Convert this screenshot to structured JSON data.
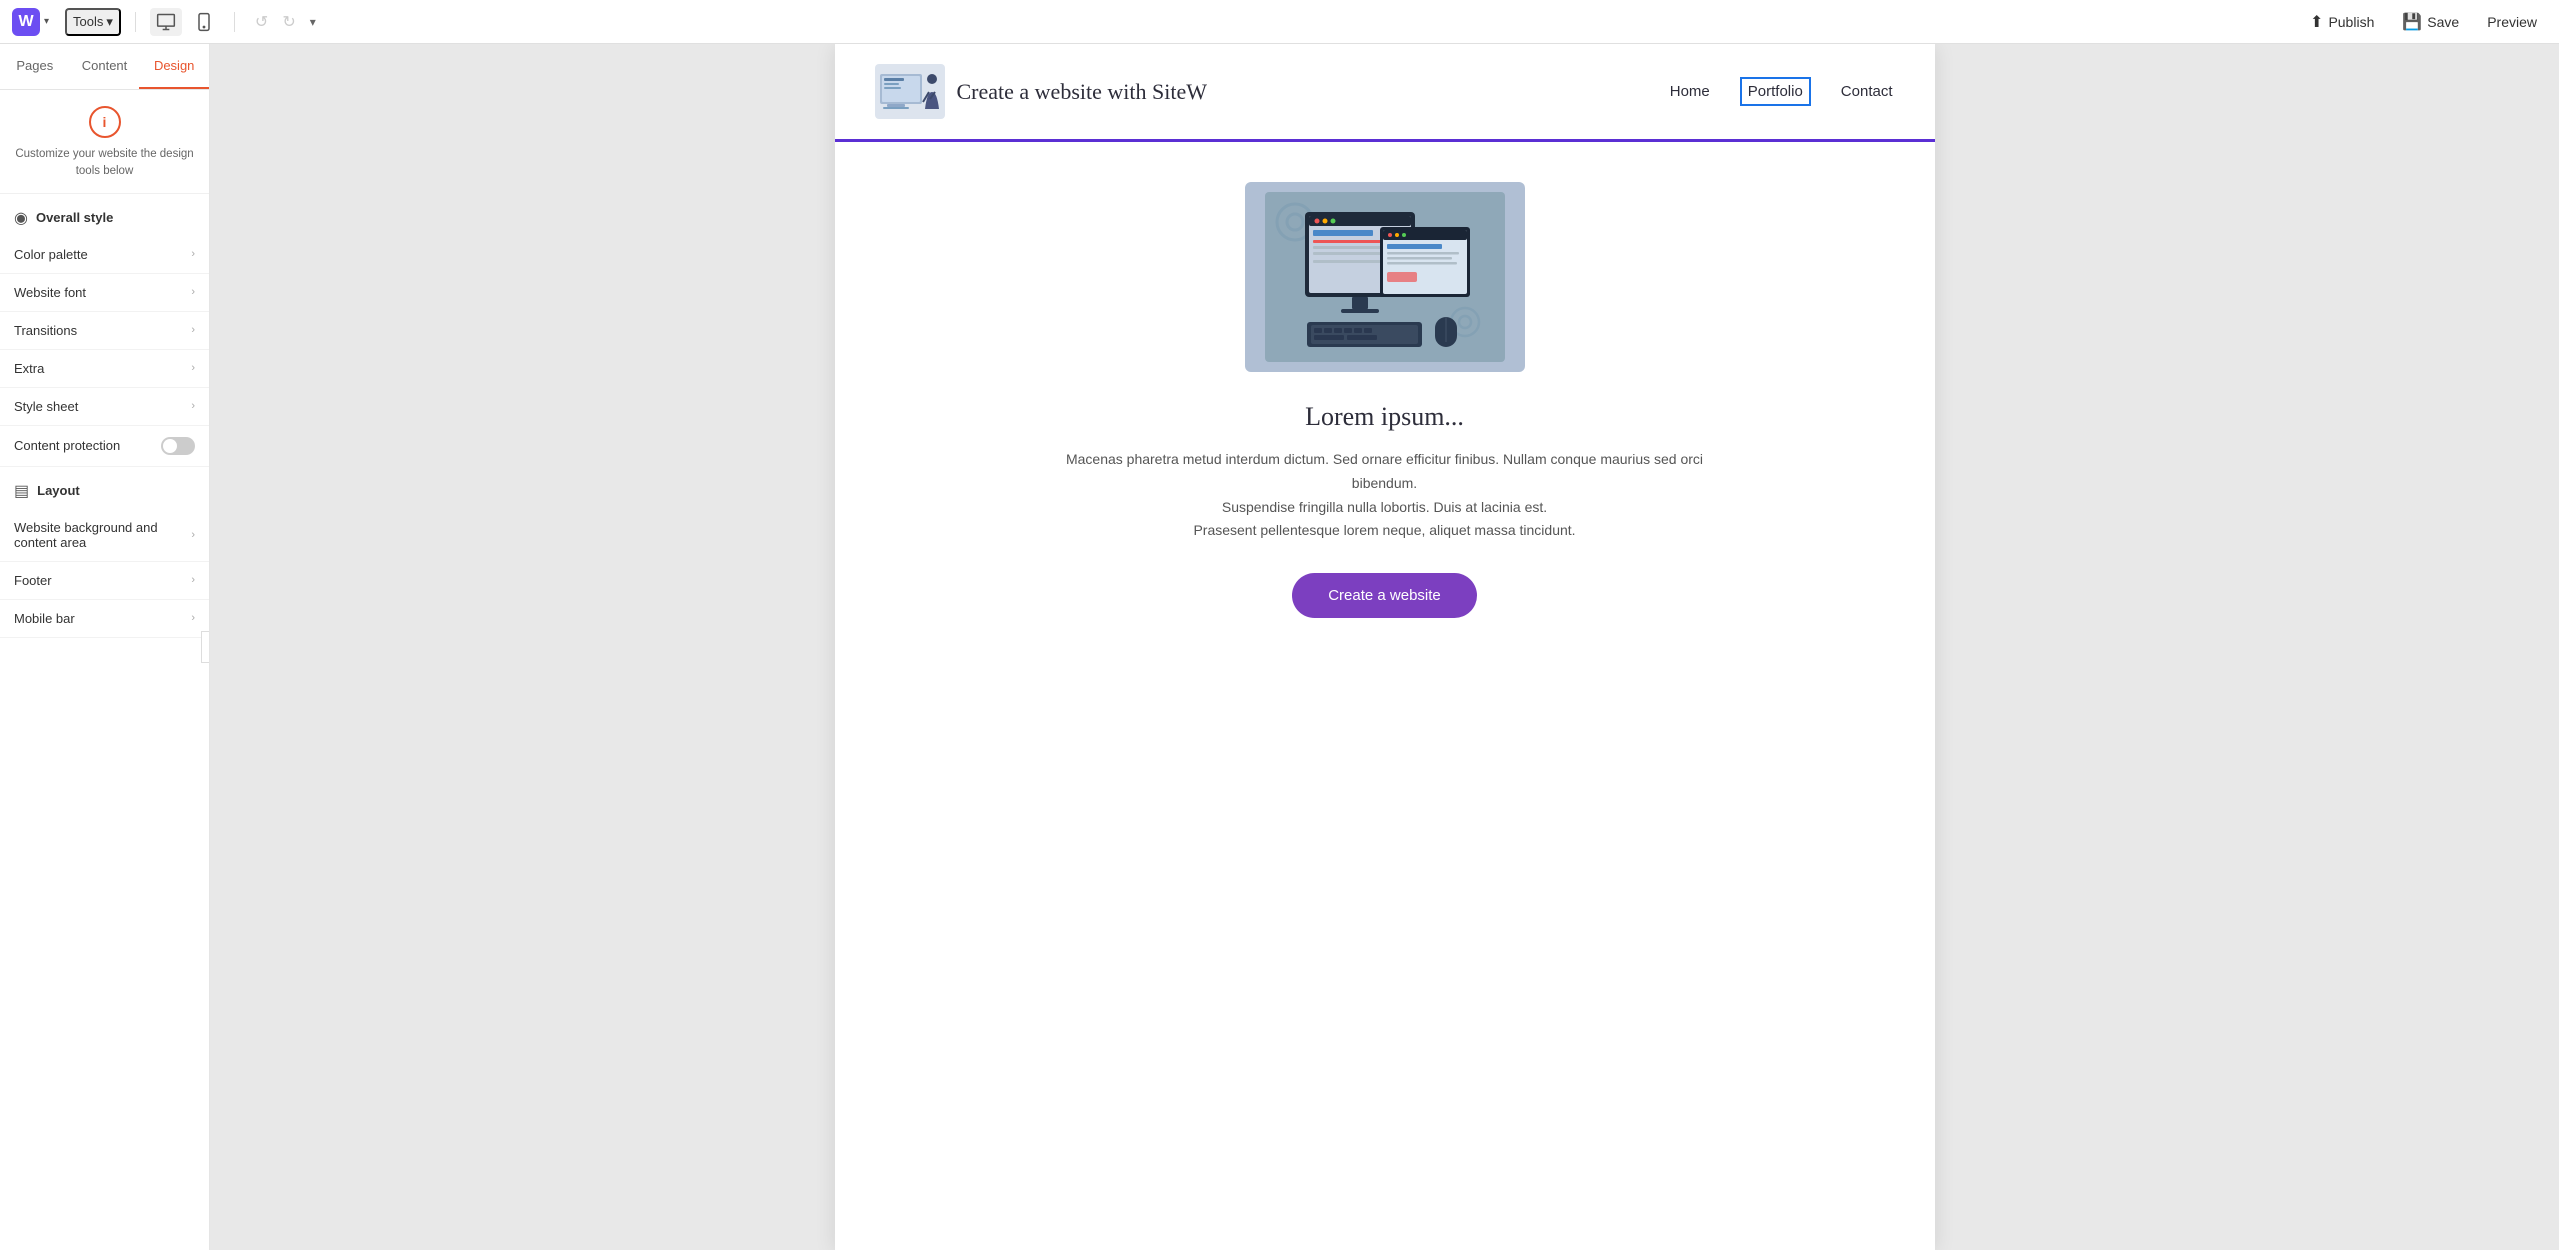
{
  "topbar": {
    "logo_letter": "W",
    "tools_label": "Tools",
    "undo_label": "↺",
    "redo_label": "↻",
    "publish_label": "Publish",
    "save_label": "Save",
    "preview_label": "Preview"
  },
  "sidebar": {
    "tabs": [
      {
        "id": "pages",
        "label": "Pages"
      },
      {
        "id": "content",
        "label": "Content"
      },
      {
        "id": "design",
        "label": "Design"
      }
    ],
    "active_tab": "design",
    "info_text": "Customize your website the design tools below",
    "overall_style_label": "Overall style",
    "menu_items": [
      {
        "id": "color-palette",
        "label": "Color palette"
      },
      {
        "id": "website-font",
        "label": "Website font"
      },
      {
        "id": "transitions",
        "label": "Transitions"
      },
      {
        "id": "extra",
        "label": "Extra"
      },
      {
        "id": "style-sheet",
        "label": "Style sheet"
      }
    ],
    "content_protection_label": "Content protection",
    "content_protection_on": false,
    "layout_label": "Layout",
    "layout_items": [
      {
        "id": "website-bg",
        "label": "Website background and content area"
      },
      {
        "id": "footer",
        "label": "Footer"
      },
      {
        "id": "mobile-bar",
        "label": "Mobile bar"
      }
    ]
  },
  "canvas": {
    "site_title": "Create a website with SiteW",
    "nav_items": [
      {
        "id": "home",
        "label": "Home"
      },
      {
        "id": "portfolio",
        "label": "Portfolio",
        "active": true
      },
      {
        "id": "contact",
        "label": "Contact"
      }
    ],
    "hero_title": "Lorem ipsum...",
    "hero_desc_lines": [
      "Macenas pharetra metud interdum dictum. Sed ornare efficitur finibus. Nullam conque maurius sed orci bibendum.",
      "Suspendise fringilla nulla lobortis. Duis at lacinia est.",
      "Prasesent pellentesque lorem neque, aliquet massa tincidunt."
    ],
    "hero_btn_label": "Create a website"
  },
  "colors": {
    "accent_orange": "#e8552e",
    "accent_purple": "#5b2fd4",
    "accent_purple2": "#7c3fc0",
    "nav_active": "#1a73e8"
  }
}
